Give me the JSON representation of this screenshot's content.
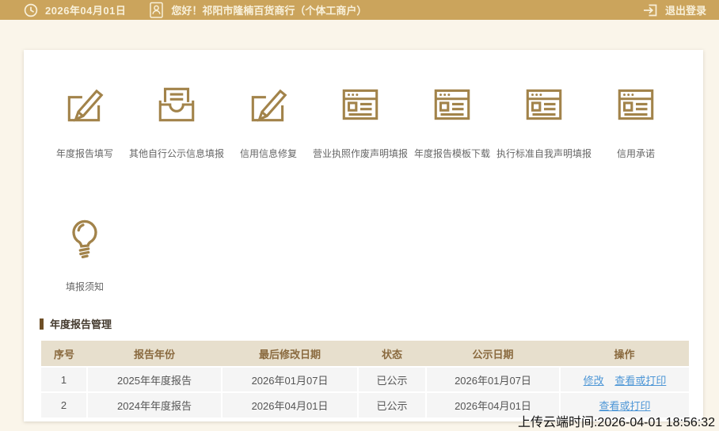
{
  "topbar": {
    "date": "2026年04月01日",
    "greeting": "您好！祁阳市隆楠百货商行（个体工商户）",
    "logout_label": "退出登录"
  },
  "nav": {
    "items": [
      {
        "label": "年度报告填写",
        "icon": "edit-square-icon"
      },
      {
        "label": "其他自行公示信息填报",
        "icon": "inbox-document-icon"
      },
      {
        "label": "信用信息修复",
        "icon": "edit-square-icon"
      },
      {
        "label": "营业执照作废声明填报",
        "icon": "form-page-icon"
      },
      {
        "label": "年度报告模板下载",
        "icon": "form-page-icon"
      },
      {
        "label": "执行标准自我声明填报",
        "icon": "form-page-icon"
      },
      {
        "label": "信用承诺",
        "icon": "form-page-icon"
      }
    ]
  },
  "notice": {
    "label": "填报须知",
    "icon": "lightbulb-icon"
  },
  "report_section": {
    "title": "年度报告管理",
    "table": {
      "headers": [
        "序号",
        "报告年份",
        "最后修改日期",
        "状态",
        "公示日期",
        "操作"
      ],
      "rows": [
        {
          "no": "1",
          "year": "2025年年度报告",
          "modified": "2026年01月07日",
          "status": "已公示",
          "published": "2026年01月07日",
          "actions": [
            "修改",
            "查看或打印"
          ]
        },
        {
          "no": "2",
          "year": "2024年年度报告",
          "modified": "2026年04月01日",
          "status": "已公示",
          "published": "2026年04月01日",
          "actions": [
            "查看或打印"
          ]
        }
      ]
    }
  },
  "footer": {
    "upload_time": "上传云端时间:2026-04-01 18:56:32"
  },
  "colors": {
    "topbar_gold": "#CBA45C",
    "icon_gold": "#A2834A",
    "table_header_bg": "#E7DFCD",
    "table_header_text": "#8A6A3F",
    "link_blue": "#4D96D6"
  }
}
